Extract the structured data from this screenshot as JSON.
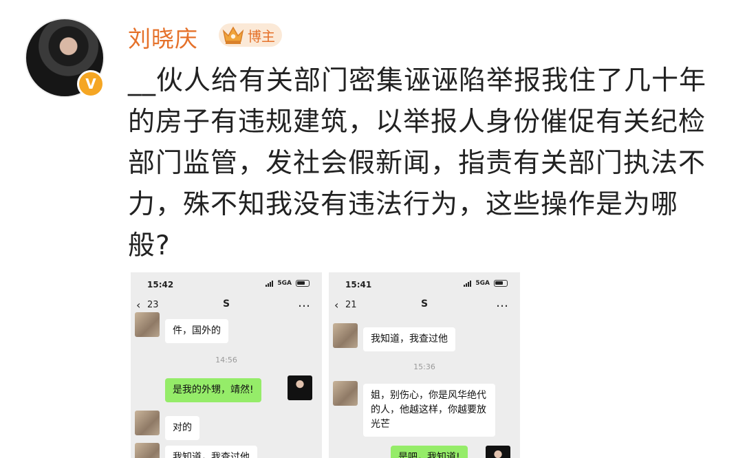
{
  "post": {
    "username": "刘晓庆",
    "badge": "博主",
    "verified_mark": "V",
    "text": "__伙人给有关部门密集诬诬陷举报我住了几十年的房子有违规建筑，以举报人身份催促有关纪检部门监管，发社会假新闻，指责有关部门执法不力，殊不知我没有违法行为，这些操作是为哪般?"
  },
  "screenshots": [
    {
      "status_time": "15:42",
      "network": "5GA",
      "back_count": "23",
      "chat_title": "S",
      "messages": [
        {
          "from": "other",
          "text": "件，国外的"
        },
        {
          "type": "time",
          "text": "14:56"
        },
        {
          "from": "me",
          "text": "是我的外甥，靖然!"
        },
        {
          "from": "other",
          "text": "对的"
        },
        {
          "from": "other",
          "text": "我知道，我查过他"
        }
      ]
    },
    {
      "status_time": "15:41",
      "network": "5GA",
      "back_count": "21",
      "chat_title": "S",
      "messages": [
        {
          "from": "other",
          "text": "我知道，我查过他"
        },
        {
          "type": "time",
          "text": "15:36"
        },
        {
          "from": "other",
          "text": "姐，别伤心，你是风华绝代的人，他越这样，你越要放光芒"
        },
        {
          "from": "me",
          "text": "是吧，我知道!"
        }
      ]
    }
  ],
  "colors": {
    "username": "#e5712a",
    "badge_bg": "#fbe9d7",
    "verified": "#f5a623",
    "bubble_me": "#95ec69",
    "chat_bg": "#ededed"
  },
  "icons": [
    "crown-icon",
    "verified-icon",
    "back-icon",
    "more-icon",
    "signal-icon",
    "battery-icon"
  ]
}
